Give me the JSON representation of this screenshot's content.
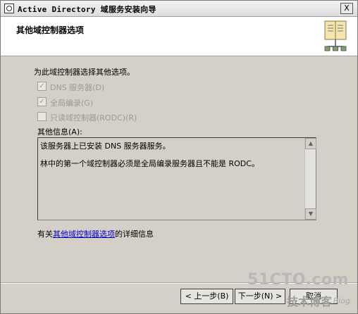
{
  "window": {
    "title": "Active Directory 域服务安装向导",
    "close_glyph": "X"
  },
  "header": {
    "title": "其他域控制器选项"
  },
  "options": {
    "instruction": "为此域控制器选择其他选项。",
    "items": [
      {
        "label": "DNS 服务器(D)",
        "checked": true
      },
      {
        "label": "全局编录(G)",
        "checked": true
      },
      {
        "label": "只读域控制器(RODC)(R)",
        "checked": false
      }
    ]
  },
  "info": {
    "label": "其他信息(A):",
    "lines": [
      "该服务器上已安装 DNS 服务器服务。",
      "林中的第一个域控制器必须是全局编录服务器且不能是 RODC。"
    ]
  },
  "more_info": {
    "prefix": "有关",
    "link_text": "其他域控制器选项",
    "suffix": "的详细信息"
  },
  "buttons": {
    "back": "< 上一步(B)",
    "next": "下一步(N) >",
    "cancel": "取消"
  },
  "watermark": {
    "main": "51CTO.com",
    "sub": "技术博客",
    "blog": "Blog"
  }
}
